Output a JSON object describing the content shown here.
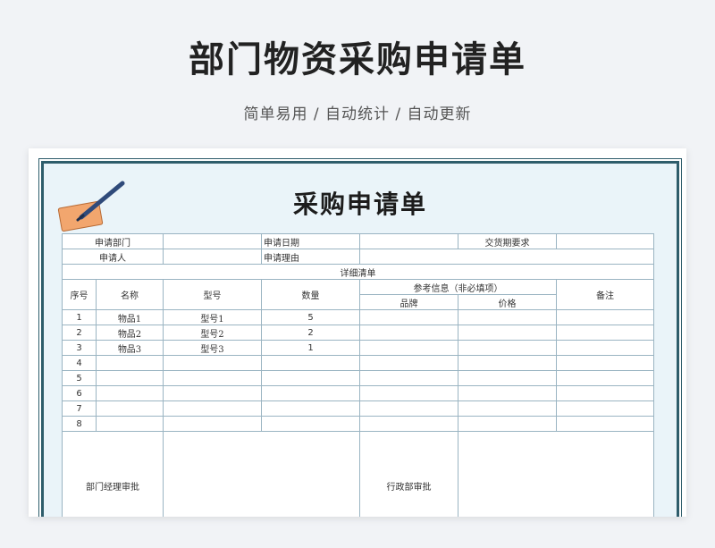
{
  "header": {
    "title": "部门物资采购申请单",
    "subtitle": "简单易用 / 自动统计 / 自动更新"
  },
  "sheet": {
    "title": "采购申请单",
    "info": {
      "dept_label": "申请部门",
      "date_label": "申请日期",
      "delivery_label": "交货期要求",
      "applicant_label": "申请人",
      "reason_label": "申请理由"
    },
    "detail_section": "详细清单",
    "columns": {
      "seq": "序号",
      "name": "名称",
      "model": "型号",
      "qty": "数量",
      "ref": "参考信息（非必填项）",
      "brand": "品牌",
      "price": "价格",
      "note": "备注"
    },
    "rows": [
      {
        "seq": "1",
        "name": "物品1",
        "model": "型号1",
        "qty": "5"
      },
      {
        "seq": "2",
        "name": "物品2",
        "model": "型号2",
        "qty": "2"
      },
      {
        "seq": "3",
        "name": "物品3",
        "model": "型号3",
        "qty": "1"
      },
      {
        "seq": "4",
        "name": "",
        "model": "",
        "qty": ""
      },
      {
        "seq": "5",
        "name": "",
        "model": "",
        "qty": ""
      },
      {
        "seq": "6",
        "name": "",
        "model": "",
        "qty": ""
      },
      {
        "seq": "7",
        "name": "",
        "model": "",
        "qty": ""
      },
      {
        "seq": "8",
        "name": "",
        "model": "",
        "qty": ""
      }
    ],
    "approval": {
      "dept_manager": "部门经理审批",
      "admin": "行政部审批"
    }
  },
  "colors": {
    "frame": "#2e5d6b",
    "label_bg": "#daeaf3",
    "section_bg": "#c6d8ee",
    "icon_paper": "#f2a66e",
    "icon_pen": "#2f4a7a"
  },
  "icons": [
    "note-pen-icon"
  ]
}
